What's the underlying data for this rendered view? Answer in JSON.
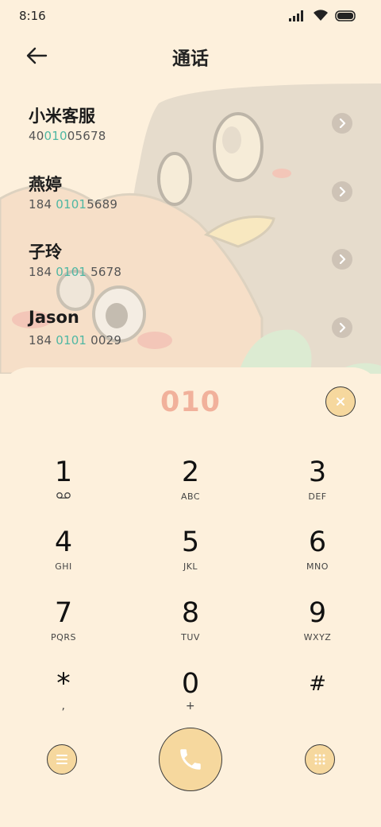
{
  "status": {
    "time": "8:16"
  },
  "header": {
    "title": "通话"
  },
  "contacts": [
    {
      "name": "小米客服",
      "num_pre": "40",
      "num_hl": "010",
      "num_post": "05678"
    },
    {
      "name": "燕婷",
      "num_pre": "184 ",
      "num_hl": "0101",
      "num_post": "5689"
    },
    {
      "name": "子玲",
      "num_pre": "184 ",
      "num_hl": "0101",
      "num_post": " 5678"
    },
    {
      "name": "Jason",
      "num_pre": "184 ",
      "num_hl": "0101",
      "num_post": " 0029"
    }
  ],
  "dialer": {
    "entered": "010",
    "keys": [
      {
        "n": "1",
        "l": ""
      },
      {
        "n": "2",
        "l": "ABC"
      },
      {
        "n": "3",
        "l": "DEF"
      },
      {
        "n": "4",
        "l": "GHI"
      },
      {
        "n": "5",
        "l": "JKL"
      },
      {
        "n": "6",
        "l": "MNO"
      },
      {
        "n": "7",
        "l": "PQRS"
      },
      {
        "n": "8",
        "l": "TUV"
      },
      {
        "n": "9",
        "l": "WXYZ"
      },
      {
        "n": "*",
        "l": ","
      },
      {
        "n": "0",
        "l": "+"
      },
      {
        "n": "#",
        "l": ""
      }
    ]
  },
  "icons": {
    "back": "arrow-left-icon",
    "voicemail": "voicemail-icon",
    "clear": "close-icon",
    "menu": "menu-icon",
    "call": "phone-icon",
    "keypad": "keypad-icon"
  },
  "colors": {
    "background": "#fdf0dc",
    "highlight": "#4fb7a3",
    "entered_digits": "#f1b19b",
    "button": "#f6d89e"
  }
}
